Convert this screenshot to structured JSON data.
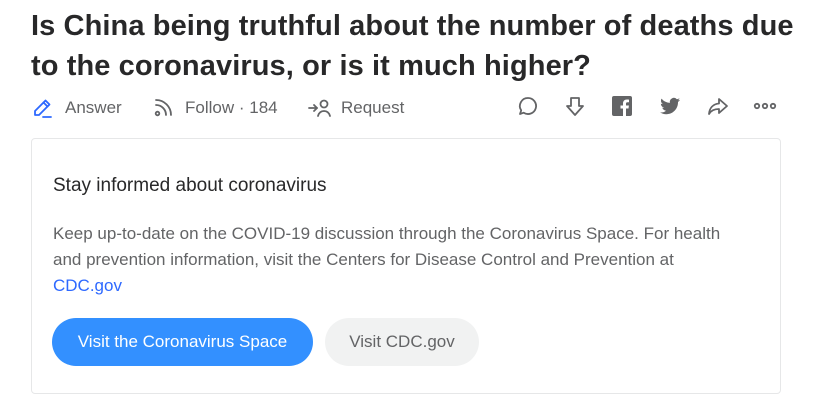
{
  "question": {
    "title": "Is China being truthful about the number of deaths due to the coronavirus, or is it much higher?"
  },
  "actions": {
    "answer_label": "Answer",
    "follow_label": "Follow",
    "follow_separator": " · ",
    "follow_count": "184",
    "request_label": "Request",
    "icons": [
      "comment-icon",
      "downvote-icon",
      "facebook-icon",
      "twitter-icon",
      "share-icon",
      "more-icon"
    ]
  },
  "card": {
    "title": "Stay informed about coronavirus",
    "body_text": "Keep up-to-date on the COVID-19 discussion through the Coronavirus Space. For health and prevention information, visit the Centers for Disease Control and Prevention at ",
    "body_link": "CDC.gov",
    "primary_button": "Visit the Coronavirus Space",
    "secondary_button": "Visit CDC.gov"
  },
  "colors": {
    "accent_blue": "#2e69ff",
    "button_blue": "#3390ff",
    "text_dark": "#282829",
    "text_gray": "#636466"
  }
}
